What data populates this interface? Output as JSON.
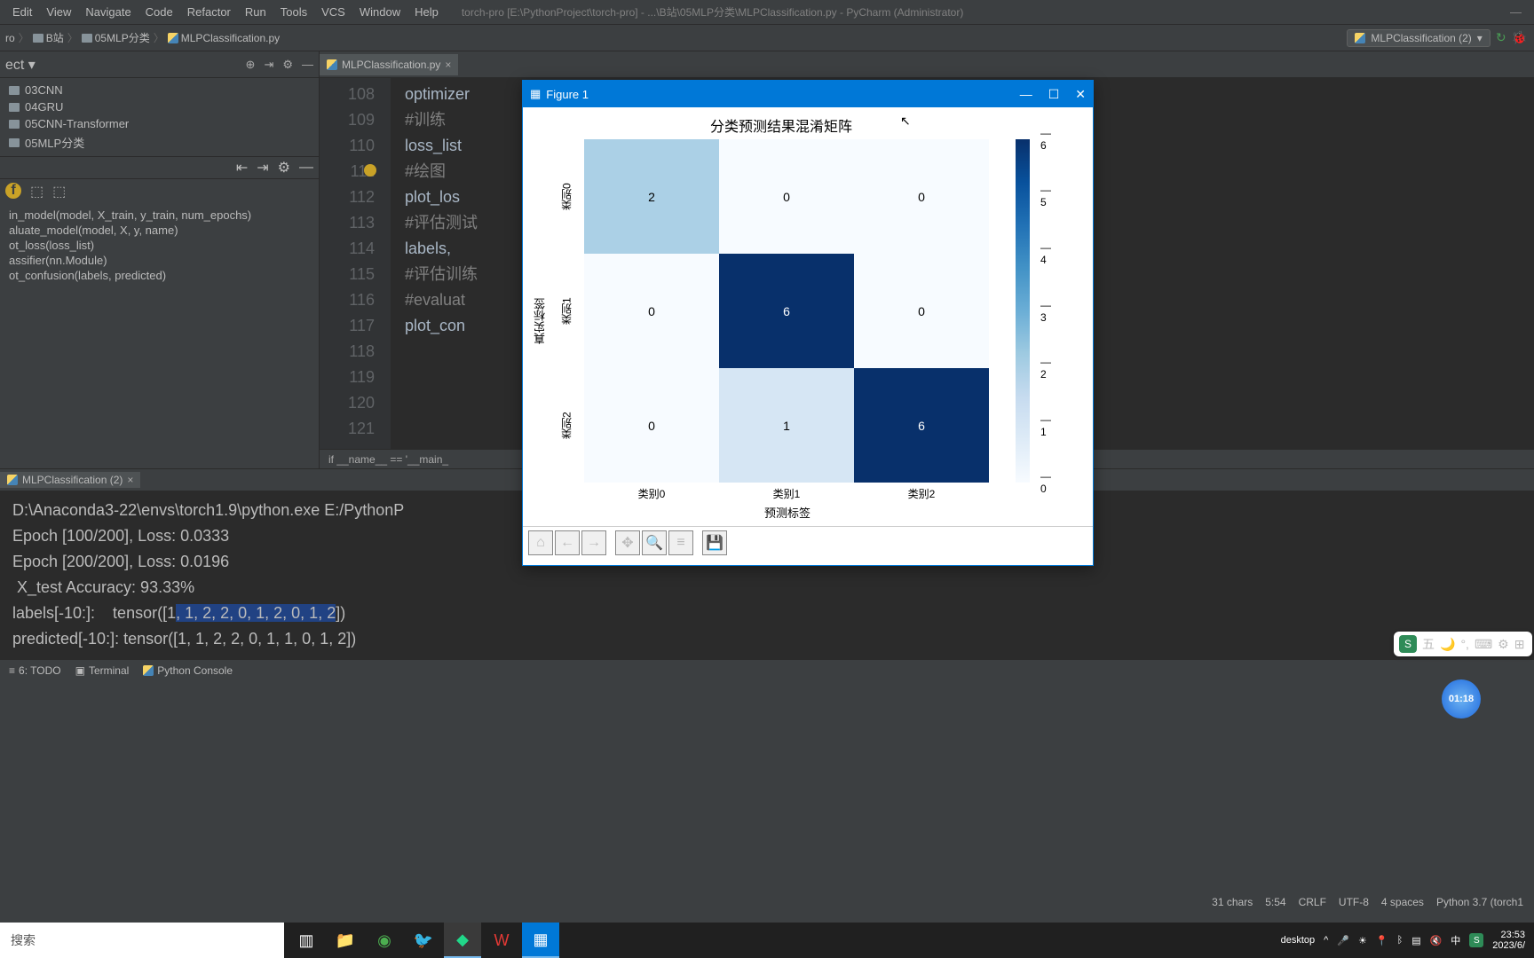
{
  "app_title": "torch-pro [E:\\PythonProject\\torch-pro] - ...\\B站\\05MLP分类\\MLPClassification.py - PyCharm (Administrator)",
  "menu": [
    "Edit",
    "View",
    "Navigate",
    "Code",
    "Refactor",
    "Run",
    "Tools",
    "VCS",
    "Window",
    "Help"
  ],
  "breadcrumbs": [
    {
      "type": "folder",
      "label": "ro"
    },
    {
      "type": "folder",
      "label": "B站"
    },
    {
      "type": "folder",
      "label": "05MLP分类"
    },
    {
      "type": "py",
      "label": "MLPClassification.py"
    }
  ],
  "run_config": {
    "name": "MLPClassification (2)"
  },
  "project_tree": [
    "03CNN",
    "04GRU",
    "05CNN-Transformer",
    "05MLP分类"
  ],
  "structure": [
    "in_model(model, X_train, y_train, num_epochs)",
    "aluate_model(model, X, y, name)",
    "ot_loss(loss_list)",
    "assifier(nn.Module)",
    "ot_confusion(labels, predicted)"
  ],
  "editor": {
    "tab_name": "MLPClassification.py",
    "line_start": 108,
    "lines": [
      {
        "n": 108,
        "text": "optimizer"
      },
      {
        "n": 109,
        "text": ""
      },
      {
        "n": 110,
        "text": "#训练",
        "cm": true
      },
      {
        "n": 111,
        "text": "loss_list",
        "bulb": true
      },
      {
        "n": 112,
        "text": ""
      },
      {
        "n": 113,
        "text": "#绘图",
        "cm": true
      },
      {
        "n": 114,
        "text": "plot_los"
      },
      {
        "n": 115,
        "text": ""
      },
      {
        "n": 116,
        "text": "#评估测试",
        "cm": true
      },
      {
        "n": 117,
        "text": "labels,"
      },
      {
        "n": 118,
        "text": "#评估训练",
        "cm": true
      },
      {
        "n": 119,
        "text": "#evaluat",
        "cm": true
      },
      {
        "n": 120,
        "text": "plot_con"
      },
      {
        "n": 121,
        "text": ""
      }
    ],
    "breadcrumb": "if __name__ == '__main_"
  },
  "run_panel": {
    "tab": "MLPClassification (2)",
    "lines": [
      "D:\\Anaconda3-22\\envs\\torch1.9\\python.exe E:/PythonP",
      "Epoch [100/200], Loss: 0.0333",
      "Epoch [200/200], Loss: 0.0196",
      " X_test Accuracy: 93.33%",
      "labels[-10:]:    tensor([1, 1, 2, 2, 0, 1, 2, 0, 1, 2])",
      "predicted[-10:]: tensor([1, 1, 2, 2, 0, 1, 1, 0, 1, 2])"
    ],
    "hl_line": 4,
    "hl_start": 26,
    "hl_end": 53
  },
  "bottom_tools": [
    "6: TODO",
    "Terminal",
    "Python Console"
  ],
  "status_bar": {
    "chars": "31 chars",
    "pos": "5:54",
    "eol": "CRLF",
    "enc": "UTF-8",
    "indent": "4 spaces",
    "py": "Python 3.7 (torch1"
  },
  "taskbar": {
    "search": "搜索",
    "desktop": "desktop",
    "time": "23:53",
    "date": "2023/6/"
  },
  "timer": "01:18",
  "ime": "五",
  "figure": {
    "title_bar": "Figure 1",
    "title": "分类预测结果混淆矩阵",
    "ylabel": "真实标签",
    "xlabel": "预测标签",
    "yticks": [
      "类别0",
      "类别1",
      "类别2"
    ],
    "xticks": [
      "类别0",
      "类别1",
      "类别2"
    ],
    "cbar_ticks": [
      "6",
      "5",
      "4",
      "3",
      "2",
      "1",
      "0"
    ]
  },
  "chart_data": {
    "type": "heatmap",
    "title": "分类预测结果混淆矩阵",
    "xlabel": "预测标签",
    "ylabel": "真实标签",
    "x_categories": [
      "类别0",
      "类别1",
      "类别2"
    ],
    "y_categories": [
      "类别0",
      "类别1",
      "类别2"
    ],
    "values": [
      [
        2,
        0,
        0
      ],
      [
        0,
        6,
        0
      ],
      [
        0,
        1,
        6
      ]
    ],
    "colorbar_range": [
      0,
      6
    ],
    "colormap": "Blues"
  }
}
